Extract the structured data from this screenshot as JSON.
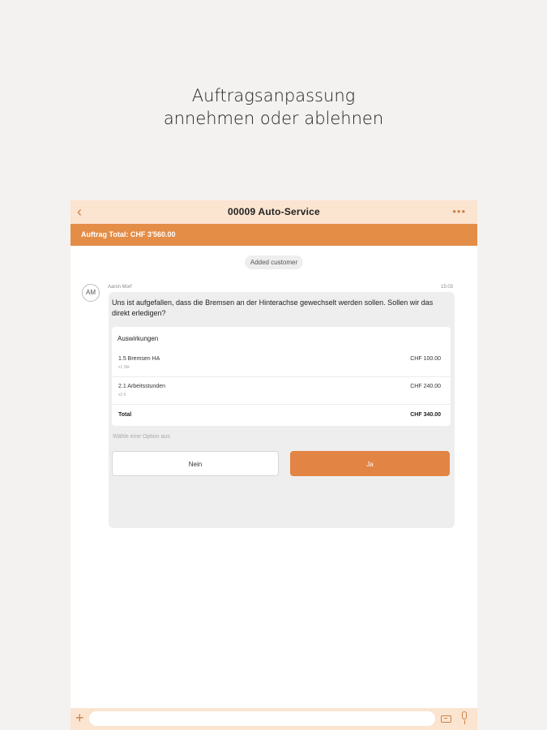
{
  "headline": {
    "line1": "Auftragsanpassung",
    "line2": "annehmen oder ablehnen"
  },
  "header": {
    "title": "00009 Auto-Service",
    "back_icon": "chevron-left-icon",
    "more_icon": "more-dots-icon"
  },
  "total_bar": {
    "text": "Auftrag Total: CHF 3'560.00"
  },
  "chat": {
    "system_message": "Added customer",
    "message": {
      "avatar_initials": "AM",
      "sender": "Aaron Morf",
      "time": "15:03",
      "text": "Uns ist aufgefallen, dass die Bremsen an der Hinterachse gewechselt werden sollen. Sollen wir das direkt erledigen?",
      "impact": {
        "title": "Auswirkungen",
        "rows": [
          {
            "label": "1.5 Bremsen HA",
            "sub": "x1 Stk",
            "value": "CHF 100.00"
          },
          {
            "label": "2.1 Arbeitsstunden",
            "sub": "x2 h",
            "value": "CHF 240.00"
          }
        ],
        "total_label": "Total",
        "total_value": "CHF 340.00"
      },
      "hint": "Wähle eine Option aus",
      "buttons": {
        "no": "Nein",
        "yes": "Ja"
      }
    }
  },
  "composer": {
    "placeholder": "",
    "plus_icon": "plus-icon",
    "template_icon": "template-icon",
    "mic_icon": "microphone-icon"
  },
  "colors": {
    "accent": "#e48d47",
    "header_bg": "#fbe4d0",
    "page_bg": "#f3f2f0"
  }
}
